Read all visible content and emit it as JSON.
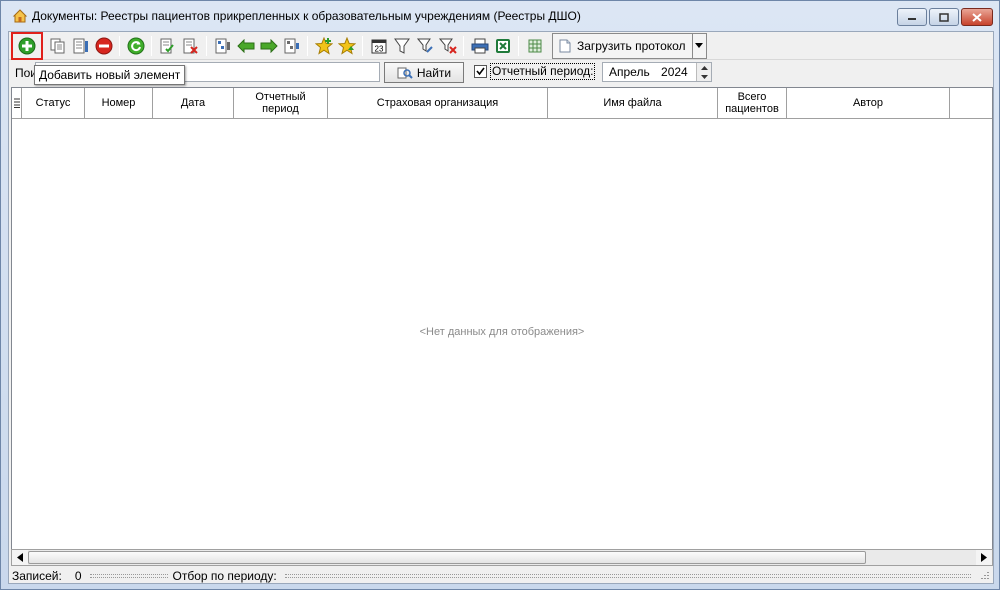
{
  "window": {
    "title": "Документы: Реестры пациентов прикрепленных к образовательным учреждениям (Реестры ДШО)"
  },
  "toolbar": {
    "add_tooltip": "Добавить новый элемент",
    "load_protocol_label": "Загрузить протокол"
  },
  "search": {
    "label": "Пои",
    "value": "",
    "find_button": "Найти"
  },
  "period": {
    "label": "Отчетный период:",
    "checked": true,
    "value": "Апрель  2024"
  },
  "grid": {
    "columns": [
      {
        "label": "Статус"
      },
      {
        "label": "Номер"
      },
      {
        "label": "Дата"
      },
      {
        "label": "Отчетный период"
      },
      {
        "label": "Страховая организация"
      },
      {
        "label": "Имя файла"
      },
      {
        "label": "Всего пациентов"
      },
      {
        "label": "Автор"
      }
    ],
    "rows": [],
    "empty_message": "<Нет данных для отображения>"
  },
  "statusbar": {
    "records_label": "Записей:",
    "records_count": "0",
    "filter_label": "Отбор по периоду:",
    "filter_value": ""
  }
}
